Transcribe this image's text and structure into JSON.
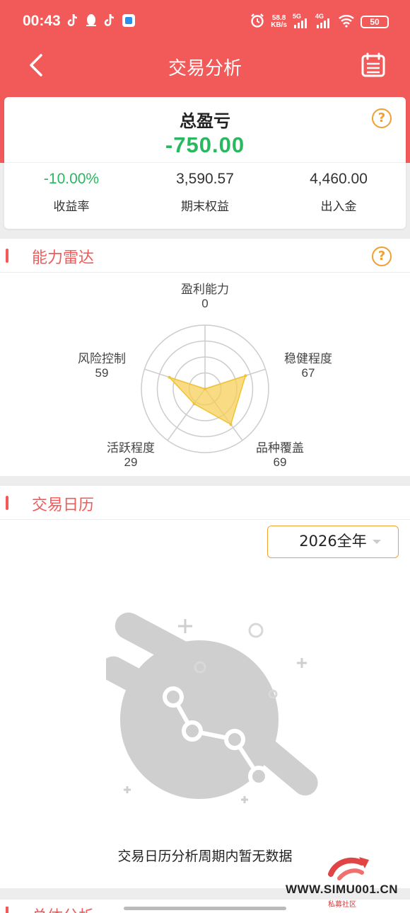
{
  "status_bar": {
    "time": "00:43",
    "speed_value": "58.8",
    "speed_unit": "KB/s",
    "net1": "5G",
    "net2": "4G",
    "battery": "50"
  },
  "header": {
    "title": "交易分析"
  },
  "summary": {
    "pl_label": "总盈亏",
    "pl_value": "-750.00",
    "help": "?",
    "metrics": [
      {
        "value": "-10.00%",
        "label": "收益率"
      },
      {
        "value": "3,590.57",
        "label": "期末权益"
      },
      {
        "value": "4,460.00",
        "label": "出入金"
      }
    ]
  },
  "radar_section": {
    "title": "能力雷达",
    "help": "?",
    "axes": [
      {
        "label": "盈利能力",
        "value": 0
      },
      {
        "label": "稳健程度",
        "value": 67
      },
      {
        "label": "品种覆盖",
        "value": 69
      },
      {
        "label": "活跃程度",
        "value": 29
      },
      {
        "label": "风险控制",
        "value": 59
      }
    ],
    "max": 100,
    "fill_color": "#f6cf5a"
  },
  "calendar_section": {
    "title": "交易日历",
    "year_select": "2026全年",
    "empty_text": "交易日历分析周期内暂无数据"
  },
  "next_section": {
    "title": "总体分析"
  },
  "watermark": {
    "url": "WWW.SIMU001.CN",
    "sub": "私募社区"
  },
  "colors": {
    "brand_red": "#f25a5a",
    "profit_green": "#28b85f",
    "accent_orange": "#f0a032"
  }
}
